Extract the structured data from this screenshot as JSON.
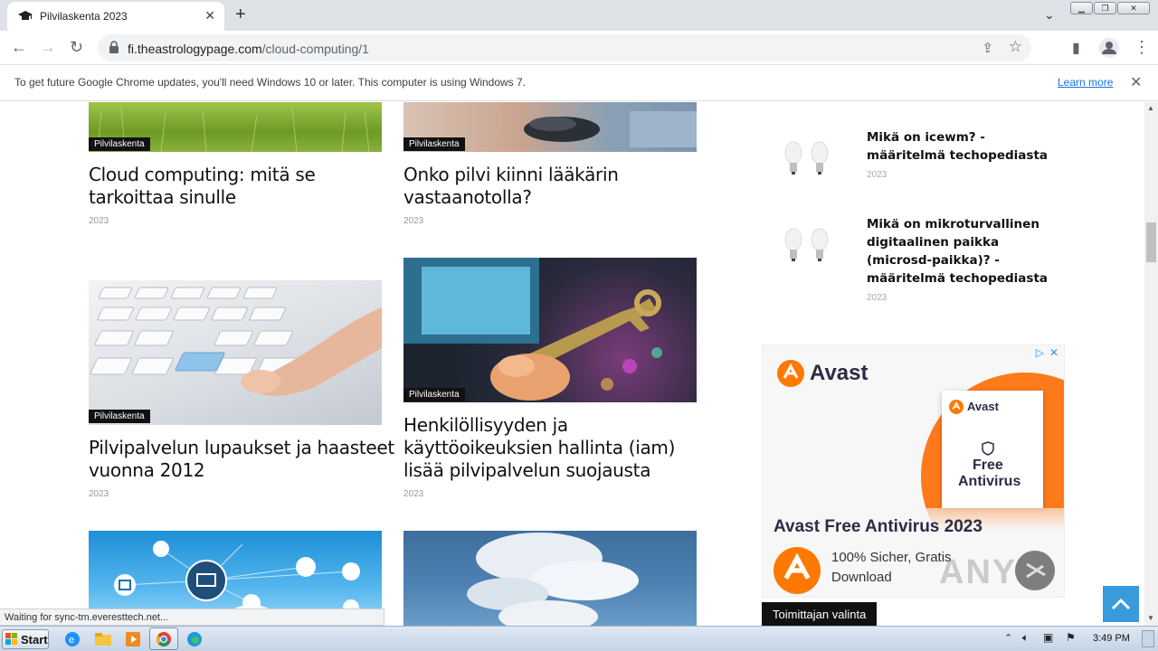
{
  "browser": {
    "tab_title": "Pilvilaskenta 2023",
    "url_host": "fi.theastrologypage.com",
    "url_path": "/cloud-computing/1"
  },
  "infobar": {
    "message": "To get future Google Chrome updates, you'll need Windows 10 or later. This computer is using Windows 7.",
    "learn_more": "Learn more"
  },
  "articles": [
    {
      "category": "Pilvilaskenta",
      "title": "Cloud computing: mitä se tarkoittaa sinulle",
      "year": "2023"
    },
    {
      "category": "Pilvilaskenta",
      "title": "Onko pilvi kiinni lääkärin vastaanotolla?",
      "year": "2023"
    },
    {
      "category": "Pilvilaskenta",
      "title": "Pilvipalvelun lupaukset ja haasteet vuonna 2012",
      "year": "2023"
    },
    {
      "category": "Pilvilaskenta",
      "title": "Henkilöllisyyden ja käyttöoikeuksien hallinta (iam) lisää pilvipalvelun suojausta",
      "year": "2023"
    }
  ],
  "sidebar": {
    "items": [
      {
        "title": "Mikä on icewm? - määritelmä techopediasta",
        "year": "2023"
      },
      {
        "title": "Mikä on mikroturvallinen digitaalinen paikka (microsd-paikka)? - määritelmä techopediasta",
        "year": "2023"
      }
    ]
  },
  "ad": {
    "brand": "Avast",
    "box_brand": "Avast",
    "box_line1": "Free",
    "box_line2": "Antivirus",
    "headline": "Avast Free Antivirus 2023",
    "sub1": "100% Sicher, Gratis",
    "sub2": "Download",
    "brand_color": "#ff7800"
  },
  "toimittaja": "Toimittajan valinta",
  "status_text": "Waiting for sync-tm.everesttech.net...",
  "taskbar": {
    "start": "Start",
    "clock": "3:49 PM"
  },
  "watermark": "ANY RUN"
}
